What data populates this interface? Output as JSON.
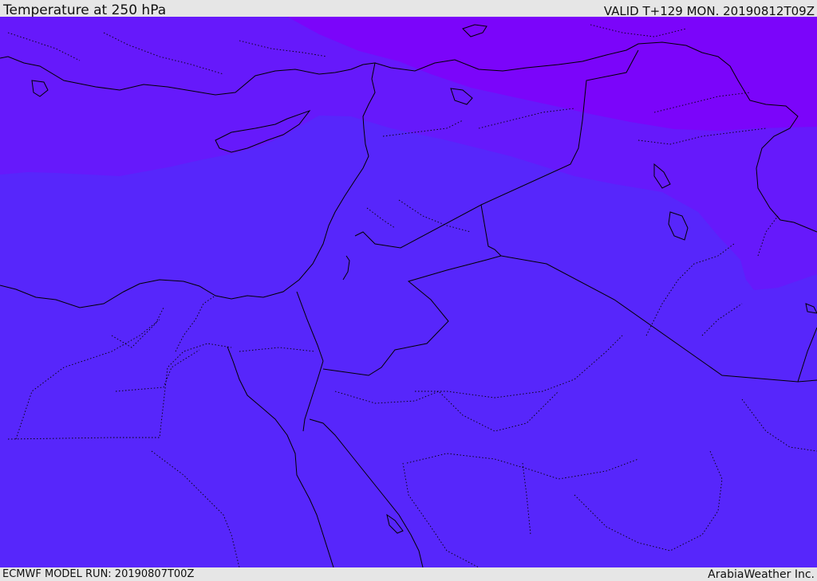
{
  "header": {
    "title": "Temperature at 250 hPa",
    "valid": "VALID T+129 MON. 20190812T09Z"
  },
  "footer": {
    "model_run": "ECMWF MODEL RUN: 20190807T00Z",
    "credit": "ArabiaWeather Inc."
  },
  "colors": {
    "band_warm": "#5726fb",
    "band_mid": "#6619fb",
    "band_cold": "#7b05fa",
    "boundary": "#000000"
  },
  "icons": {
    "map": "weather-map"
  }
}
